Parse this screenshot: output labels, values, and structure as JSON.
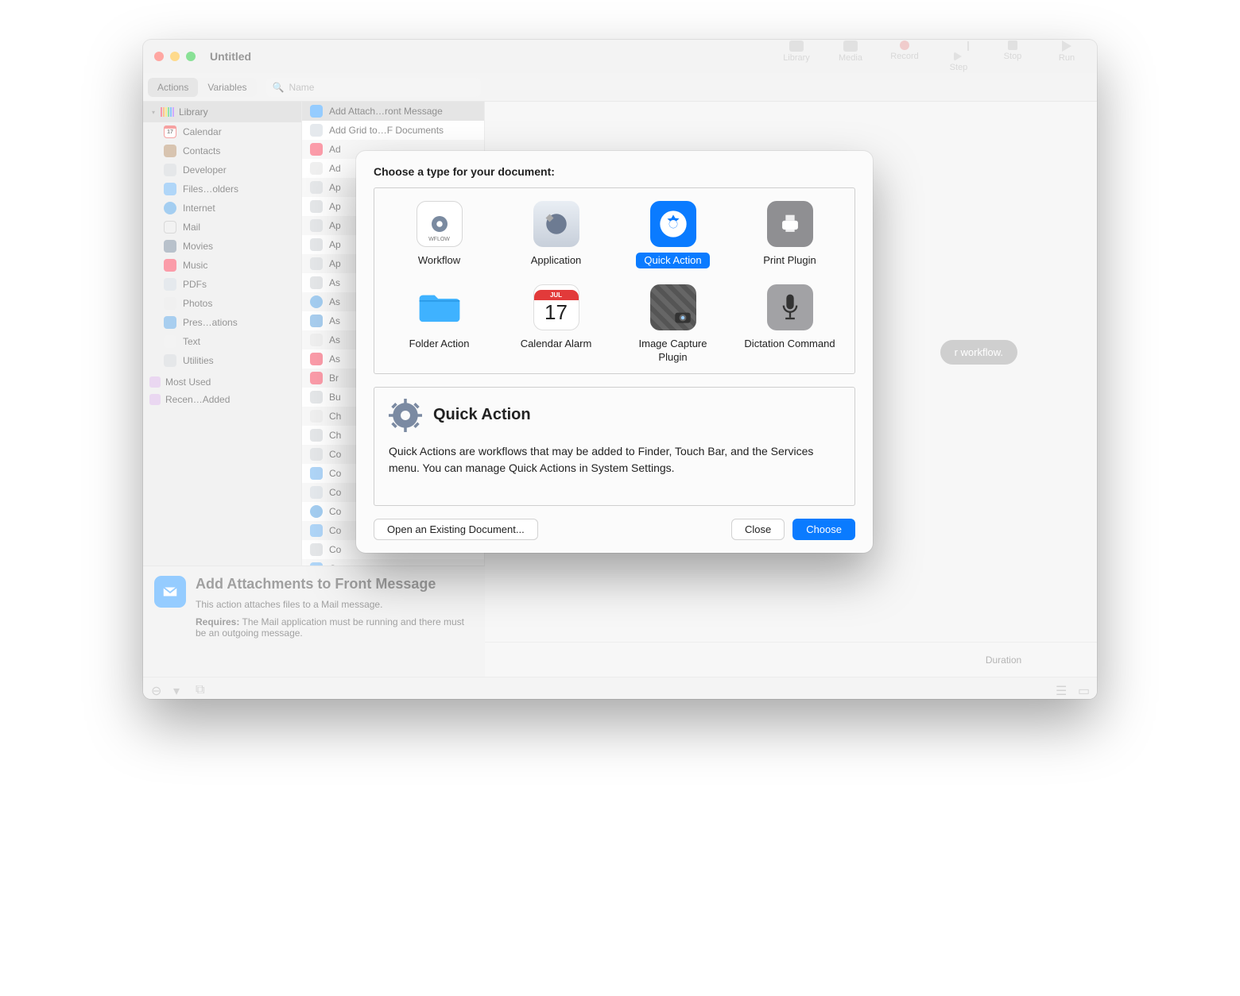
{
  "window": {
    "title": "Untitled"
  },
  "toolbar": {
    "library": "Library",
    "media": "Media",
    "record": "Record",
    "step": "Step",
    "stop": "Stop",
    "run": "Run"
  },
  "tabs": {
    "actions": "Actions",
    "variables": "Variables"
  },
  "search": {
    "placeholder": "Name"
  },
  "library": {
    "header": "Library",
    "items": [
      {
        "icon": "cal",
        "label": "Calendar"
      },
      {
        "icon": "contacts",
        "label": "Contacts"
      },
      {
        "icon": "dev",
        "label": "Developer"
      },
      {
        "icon": "files",
        "label": "Files…olders"
      },
      {
        "icon": "internet",
        "label": "Internet"
      },
      {
        "icon": "mail",
        "label": "Mail"
      },
      {
        "icon": "movies",
        "label": "Movies"
      },
      {
        "icon": "music",
        "label": "Music"
      },
      {
        "icon": "pdfs",
        "label": "PDFs"
      },
      {
        "icon": "photos",
        "label": "Photos"
      },
      {
        "icon": "pres",
        "label": "Pres…ations"
      },
      {
        "icon": "text",
        "label": "Text"
      },
      {
        "icon": "util",
        "label": "Utilities"
      }
    ],
    "smart": [
      {
        "label": "Most Used"
      },
      {
        "label": "Recen…Added"
      }
    ]
  },
  "actions": {
    "items": [
      {
        "icon": "mailblue",
        "label": "Add Attach…ront Message",
        "sel": true
      },
      {
        "icon": "pdfs",
        "label": "Add Grid to…F Documents"
      },
      {
        "icon": "music",
        "label": "Ad"
      },
      {
        "icon": "photos",
        "label": "Ad"
      },
      {
        "icon": "util",
        "label": "Ap"
      },
      {
        "icon": "dev",
        "label": "Ap"
      },
      {
        "icon": "util",
        "label": "Ap"
      },
      {
        "icon": "dev",
        "label": "Ap"
      },
      {
        "icon": "util",
        "label": "Ap"
      },
      {
        "icon": "dev",
        "label": "As"
      },
      {
        "icon": "internet",
        "label": "As"
      },
      {
        "icon": "pres",
        "label": "As"
      },
      {
        "icon": "photos",
        "label": "As"
      },
      {
        "icon": "music",
        "label": "As"
      },
      {
        "icon": "music",
        "label": "Br"
      },
      {
        "icon": "util",
        "label": "Bu"
      },
      {
        "icon": "photos",
        "label": "Ch"
      },
      {
        "icon": "dev",
        "label": "Ch"
      },
      {
        "icon": "dev",
        "label": "Co"
      },
      {
        "icon": "files",
        "label": "Co"
      },
      {
        "icon": "pdfs",
        "label": "Co"
      },
      {
        "icon": "internet",
        "label": "Co"
      },
      {
        "icon": "files",
        "label": "Co"
      },
      {
        "icon": "dev",
        "label": "Co"
      },
      {
        "icon": "files",
        "label": "Co"
      }
    ]
  },
  "description": {
    "title": "Add Attachments to Front Message",
    "body": "This action attaches files to a Mail message.",
    "requires_label": "Requires:",
    "requires": "The Mail application must be running and there must be an outgoing message."
  },
  "canvas_hint_suffix": "r workflow.",
  "log_columns": {
    "duration": "Duration"
  },
  "calalarm": {
    "month": "JUL",
    "day": "17"
  },
  "dialog": {
    "title": "Choose a type for your document:",
    "options": [
      {
        "key": "workflow",
        "label": "Workflow"
      },
      {
        "key": "application",
        "label": "Application"
      },
      {
        "key": "quick",
        "label": "Quick Action",
        "selected": true
      },
      {
        "key": "print",
        "label": "Print Plugin"
      },
      {
        "key": "folder",
        "label": "Folder Action"
      },
      {
        "key": "calalarm",
        "label": "Calendar Alarm"
      },
      {
        "key": "image",
        "label": "Image Capture Plugin"
      },
      {
        "key": "dict",
        "label": "Dictation Command"
      }
    ],
    "detail": {
      "heading": "Quick Action",
      "text": "Quick Actions are workflows that may be added to Finder, Touch Bar, and the Services menu. You can manage Quick Actions in System Settings."
    },
    "buttons": {
      "open_existing": "Open an Existing Document...",
      "close": "Close",
      "choose": "Choose"
    }
  }
}
